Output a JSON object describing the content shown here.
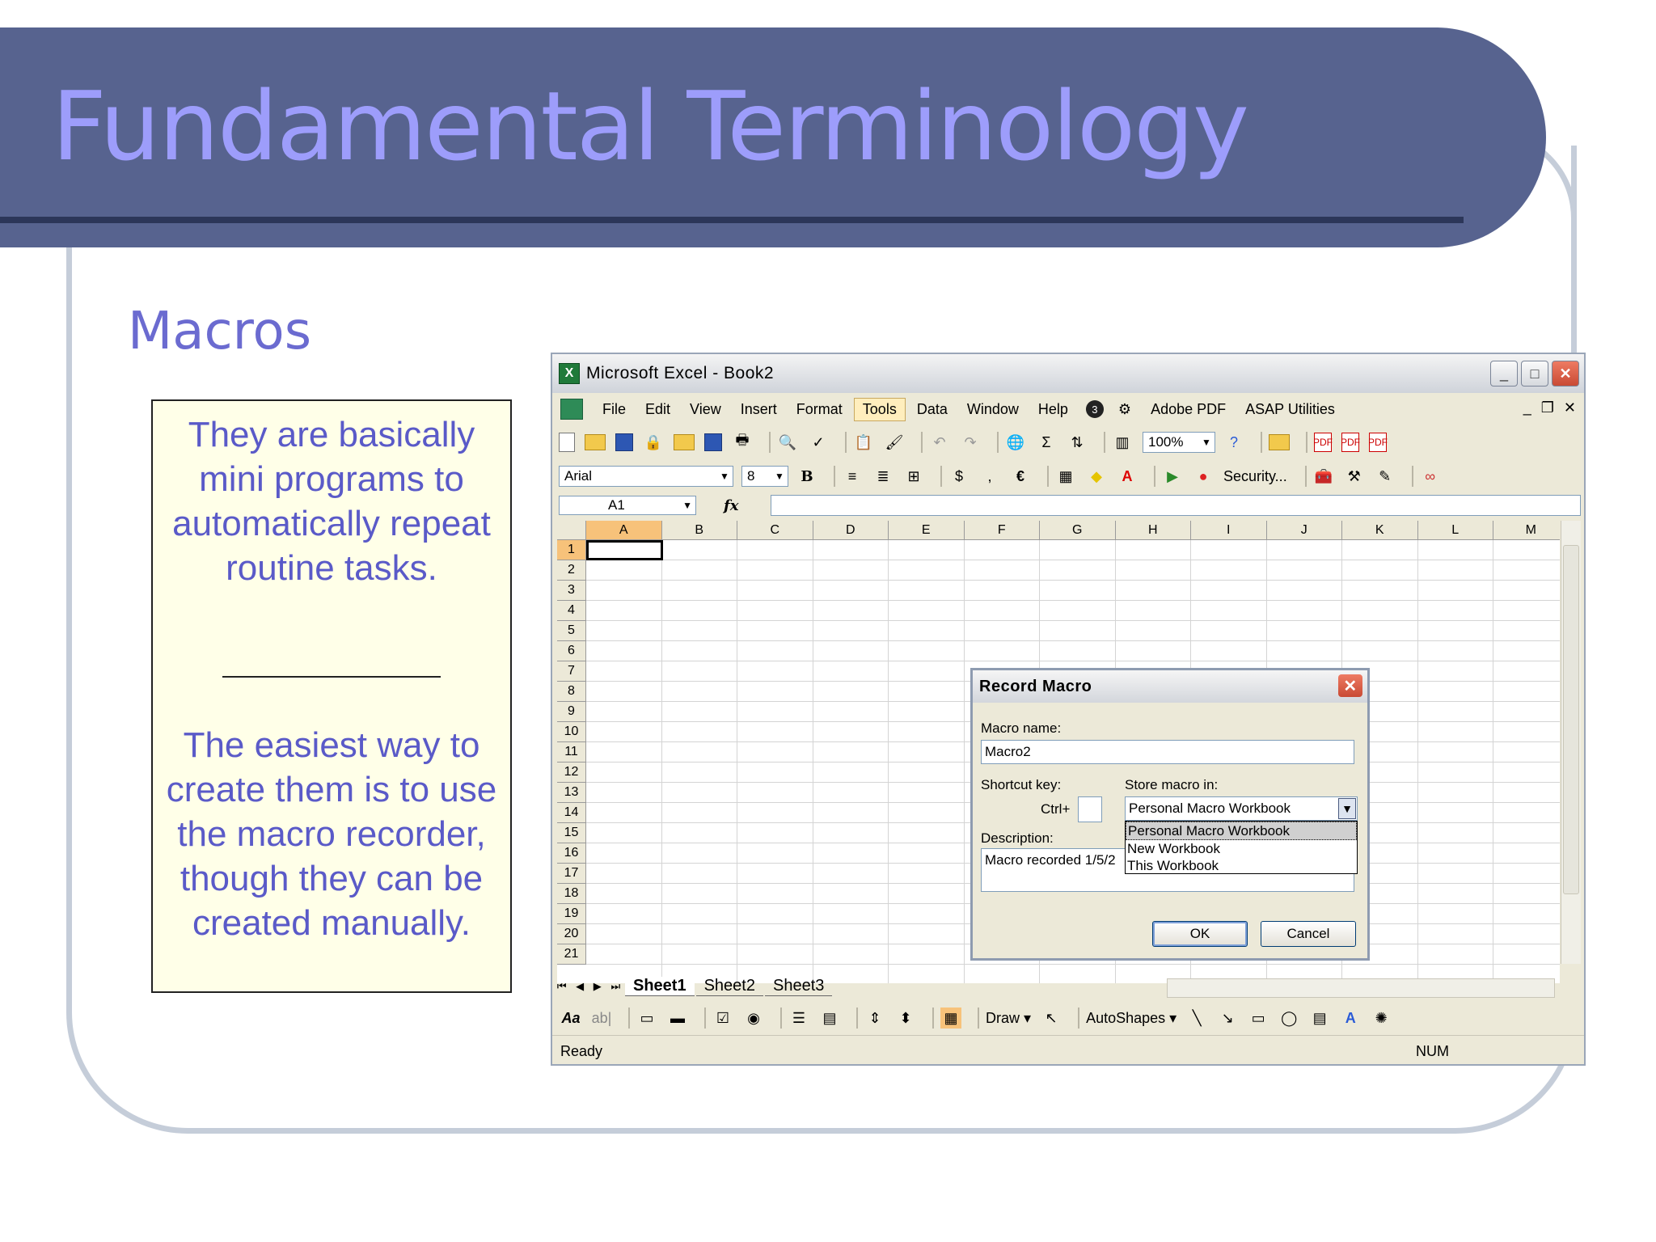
{
  "slide": {
    "title": "Fundamental Terminology",
    "subtitle": "Macros",
    "note_1": "They are basically mini programs to automatically repeat routine tasks.",
    "note_2": "The easiest way to create them is to use the macro recorder, though they can be created manually."
  },
  "excel": {
    "window_title": "Microsoft Excel - Book2",
    "menu": [
      "File",
      "Edit",
      "View",
      "Insert",
      "Format",
      "Tools",
      "Data",
      "Window",
      "Help",
      "Adobe PDF",
      "ASAP Utilities"
    ],
    "active_menu": "Tools",
    "zoom": "100%",
    "font_name": "Arial",
    "font_size": "8",
    "security_label": "Security...",
    "name_box": "A1",
    "fx": "fx",
    "columns": [
      "A",
      "B",
      "C",
      "D",
      "E",
      "F",
      "G",
      "H",
      "I",
      "J",
      "K",
      "L",
      "M"
    ],
    "rows": [
      "1",
      "2",
      "3",
      "4",
      "5",
      "6",
      "7",
      "8",
      "9",
      "10",
      "11",
      "12",
      "13",
      "14",
      "15",
      "16",
      "17",
      "18",
      "19",
      "20",
      "21"
    ],
    "sheets": [
      "Sheet1",
      "Sheet2",
      "Sheet3"
    ],
    "draw_label": "Draw",
    "autoshapes_label": "AutoShapes",
    "status": "Ready",
    "num_indicator": "NUM"
  },
  "dialog": {
    "title": "Record Macro",
    "macro_name_label": "Macro name:",
    "macro_name": "Macro2",
    "shortcut_label": "Shortcut key:",
    "ctrl_label": "Ctrl+",
    "store_label": "Store macro in:",
    "store_value": "Personal Macro Workbook",
    "store_options": [
      "Personal Macro Workbook",
      "New Workbook",
      "This Workbook"
    ],
    "description_label": "Description:",
    "description": "Macro recorded 1/5/2",
    "ok": "OK",
    "cancel": "Cancel"
  }
}
